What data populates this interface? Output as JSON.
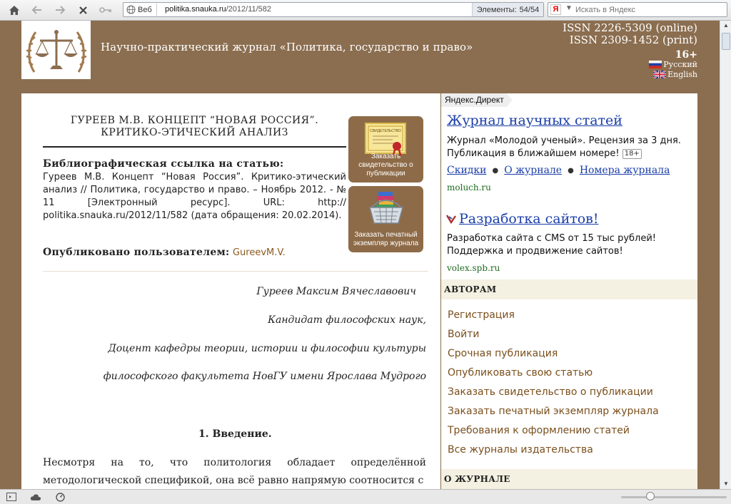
{
  "browser": {
    "address_web_label": "Веб",
    "url_host": "politika.snauka.ru",
    "url_path": "/2012/11/582",
    "elements_label": "Элементы:",
    "elements_count": "54/54",
    "search_logo": "Я",
    "search_placeholder": "Искать в Яндекс"
  },
  "site": {
    "title": "Научно-практический журнал «Политика, государство и право»",
    "issn_online": "ISSN 2226-5309 (online)",
    "issn_print": "ISSN 2309-1452 (print)",
    "age_rating": "16+",
    "lang_ru": "Русский",
    "lang_en": "English"
  },
  "article": {
    "title_line1": "ГУРЕЕВ М.В. КОНЦЕПТ “НОВАЯ РОССИЯ”.",
    "title_line2": "КРИТИКО-ЭТИЧЕСКИЙ АНАЛИЗ",
    "bib_label": "Библиографическая ссылка на статью:",
    "bib_text": "Гуреев М.В. Концепт “Новая Россия”. Критико-этический анализ // Политика, государство и право. – Ноябрь 2012. - № 11 [Электронный ресурс]. URL: http:// politika.snauka.ru/2012/11/582 (дата обращения: 20.02.2014).",
    "published_label": "Опубликовано пользователем:",
    "published_user": "GureevM.V.",
    "author_name": "Гуреев Максим Вячеславович",
    "author_degree": "Кандидат философских наук,",
    "author_post": "Доцент кафедры теории, истории и философии культуры",
    "author_faculty": "философского факультета НовГУ имени Ярослава Мудрого",
    "intro_heading": "1. Введение.",
    "intro_text": "Несмотря на то, что политология обладает определённой методологической спецификой, она всё равно напрямую соотносится с"
  },
  "order_buttons": {
    "certificate": "Заказать свидетельство о публикации",
    "certificate_img_text": "СВИДЕТЕЛЬСТВО",
    "print_copy": "Заказать печатный экземпляр журнала"
  },
  "ads": {
    "tab_label": "Яндекс.Директ",
    "ad1_title": "Журнал научных статей",
    "ad1_text": "Журнал «Молодой ученый». Рецензия за 3 дня. Публикация в ближайшем номере!",
    "ad1_badge": "18+",
    "ad1_links": [
      "Скидки",
      "О журнале",
      "Номера журнала"
    ],
    "ad1_domain": "moluch.ru",
    "ad2_title": "Разработка сайтов!",
    "ad2_text": "Разработка сайта с CMS от 15 тыс рублей! Поддержка и продвижение сайтов!",
    "ad2_domain": "volex.spb.ru"
  },
  "sidebar": {
    "authors_header": "АВТОРАМ",
    "authors_menu": [
      "Регистрация",
      "Войти",
      "Срочная публикация",
      "Опубликовать свою статью",
      "Заказать свидетельство о публикации",
      "Заказать печатный экземпляр журнала",
      "Требования к оформлению статей",
      "Все журналы издательства"
    ],
    "journal_header": "О ЖУРНАЛЕ"
  },
  "colors": {
    "page_background": "#8b6e50",
    "menu_link": "#7a4f1c",
    "ad_link": "#1a3ea8",
    "ad_domain": "#1e6b1e"
  }
}
